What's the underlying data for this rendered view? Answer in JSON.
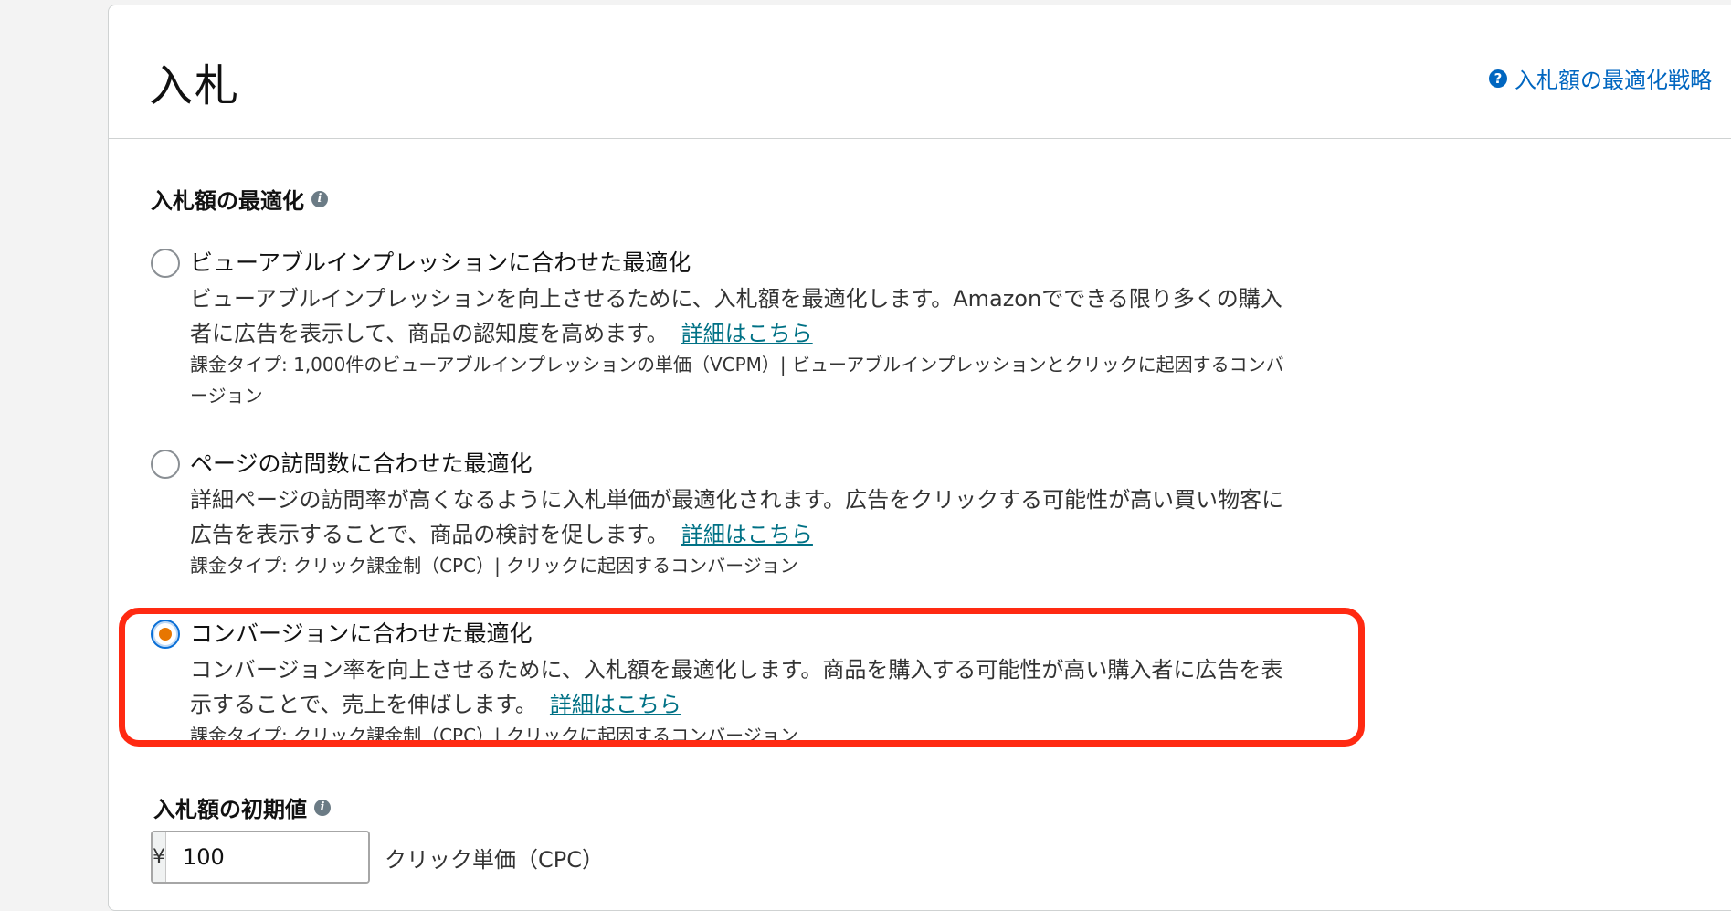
{
  "header": {
    "title": "入札",
    "strategy_link": "入札額の最適化戦略"
  },
  "optimization": {
    "title": "入札額の最適化",
    "options": [
      {
        "label": "ビューアブルインプレッションに合わせた最適化",
        "desc": "ビューアブルインプレッションを向上させるために、入札額を最適化します。Amazonでできる限り多くの購入者に広告を表示して、商品の認知度を高めます。",
        "link": "詳細はこちら",
        "billing": "課金タイプ: 1,000件のビューアブルインプレッションの単価（VCPM）| ビューアブルインプレッションとクリックに起因するコンバージョン",
        "selected": false
      },
      {
        "label": "ページの訪問数に合わせた最適化",
        "desc": "詳細ページの訪問率が高くなるように入札単価が最適化されます。広告をクリックする可能性が高い買い物客に広告を表示することで、商品の検討を促します。",
        "link": "詳細はこちら",
        "billing": "課金タイプ: クリック課金制（CPC）| クリックに起因するコンバージョン",
        "selected": false
      },
      {
        "label": "コンバージョンに合わせた最適化",
        "desc": "コンバージョン率を向上させるために、入札額を最適化します。商品を購入する可能性が高い購入者に広告を表示することで、売上を伸ばします。",
        "link": "詳細はこちら",
        "billing": "課金タイプ: クリック課金制（CPC）| クリックに起因するコンバージョン",
        "selected": true
      }
    ]
  },
  "initial_bid": {
    "title": "入札額の初期値",
    "currency": "¥",
    "value": "100",
    "suffix": "クリック単価（CPC）"
  },
  "colors": {
    "link": "#007185",
    "radio_selected": "#e77600",
    "highlight": "#ff2a12"
  }
}
